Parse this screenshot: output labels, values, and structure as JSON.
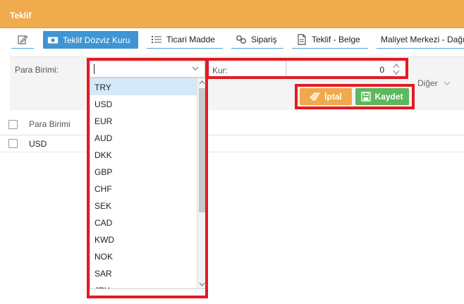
{
  "window": {
    "title": "Teklif"
  },
  "tabs": [
    {
      "label": "",
      "icon": "edit-icon"
    },
    {
      "label": "Teklif Dözviz Kuru",
      "icon": "money-icon"
    },
    {
      "label": "Ticari Madde",
      "icon": "list-icon"
    },
    {
      "label": "Sipariş",
      "icon": "link-icon"
    },
    {
      "label": "Teklif - Belge",
      "icon": "document-icon"
    },
    {
      "label": "Maliyet Merkezi - Dağı",
      "icon": ""
    }
  ],
  "form": {
    "para_birimi_label": "Para Birimi:",
    "para_birimi_value": "",
    "kur_label": "Kur:",
    "kur_value": "0",
    "diger_label": "Diğer"
  },
  "buttons": {
    "iptal": "İptal",
    "kaydet": "Kaydet"
  },
  "grid": {
    "header": "Para Birimi",
    "rows": [
      {
        "para_birimi": "USD"
      }
    ]
  },
  "dropdown": {
    "items": [
      "TRY",
      "USD",
      "EUR",
      "AUD",
      "DKK",
      "GBP",
      "CHF",
      "SEK",
      "CAD",
      "KWD",
      "NOK",
      "SAR",
      "JPY"
    ],
    "selected": "TRY"
  },
  "colors": {
    "title_bar": "#f0ab4d",
    "active_tab": "#3f95d3",
    "iptal_button": "#f2a94a",
    "kaydet_button": "#5cb85c",
    "highlight": "#e31b23"
  }
}
